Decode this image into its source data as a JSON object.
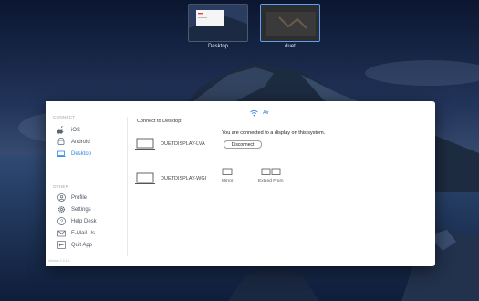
{
  "spaces": [
    {
      "label": "Desktop"
    },
    {
      "label": "duet"
    }
  ],
  "window": {
    "close_glyph": "×",
    "sidebar": {
      "connect_header": "CONNECT",
      "other_header": "OTHER",
      "connect_items": [
        {
          "label": "iOS",
          "icon": "apple-icon"
        },
        {
          "label": "Android",
          "icon": "android-icon"
        },
        {
          "label": "Desktop",
          "icon": "laptop-icon",
          "active": true
        }
      ],
      "other_items": [
        {
          "label": "Profile",
          "icon": "profile-icon"
        },
        {
          "label": "Settings",
          "icon": "gear-icon"
        },
        {
          "label": "Help Desk",
          "icon": "help-icon"
        },
        {
          "label": "E-Mail Us",
          "icon": "mail-icon"
        },
        {
          "label": "Quit App",
          "icon": "power-icon"
        }
      ],
      "version": "Version 2.3.1.0"
    },
    "connect_title": "Connect to Desktop:",
    "devices": [
      {
        "name": "DUETDISPLAY-LVA"
      },
      {
        "name": "DUETDISPLAY-WGI"
      }
    ],
    "air": {
      "label": "Air"
    },
    "status_text": "You are connected to a display on this system.",
    "disconnect_label": "Disconnect",
    "modes": [
      {
        "label": "Mirror"
      },
      {
        "label": "Extend From"
      }
    ]
  },
  "colors": {
    "accent": "#2e86de",
    "window_bg": "#ffffff",
    "thumb_selected_border": "#5c9df5"
  }
}
